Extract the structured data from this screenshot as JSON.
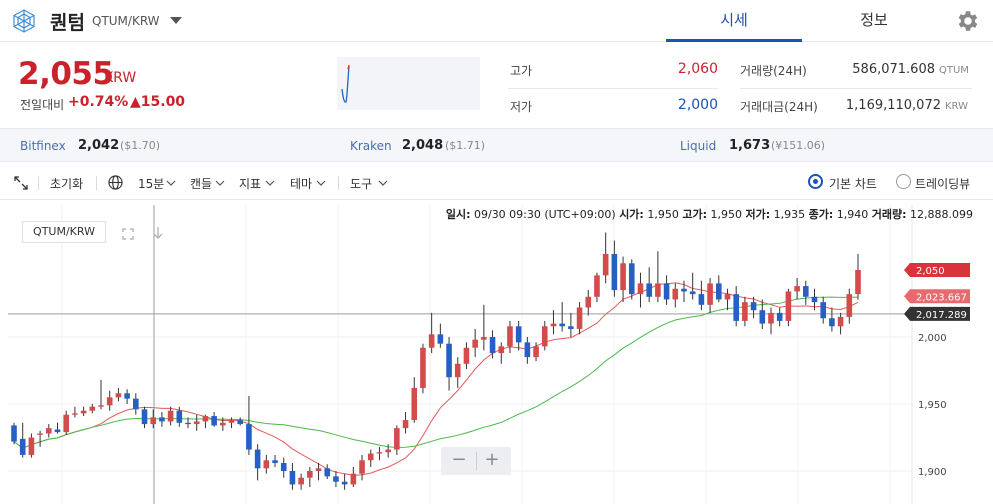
{
  "header": {
    "coin_name": "퀀텀",
    "pair": "QTUM/KRW",
    "tabs": [
      {
        "label": "시세",
        "active": true
      },
      {
        "label": "정보",
        "active": false
      }
    ],
    "icons": {
      "logo": "qtum-logo-icon",
      "dropdown": "triangle-down-icon",
      "settings": "gear-icon"
    }
  },
  "price": {
    "current": "2,055",
    "unit": "KRW",
    "change_label": "전일대비",
    "change_pct": "+0.74%",
    "change_abs": "▲15.00",
    "color": "#c8232c"
  },
  "stats": {
    "high_label": "고가",
    "high_value": "2,060",
    "high_color": "#c8232c",
    "low_label": "저가",
    "low_value": "2,000",
    "low_color": "#1a52b5",
    "volume_label": "거래량(24H)",
    "volume_value": "586,071.608",
    "volume_unit": "QTUM",
    "amount_label": "거래대금(24H)",
    "amount_value": "1,169,110,072",
    "amount_unit": "KRW"
  },
  "exchanges": [
    {
      "name": "Bitfinex",
      "price": "2,042",
      "sub": "($1.70)"
    },
    {
      "name": "Kraken",
      "price": "2,048",
      "sub": "($1.71)"
    },
    {
      "name": "Liquid",
      "price": "1,673",
      "sub": "(¥151.06)"
    }
  ],
  "toolbar": {
    "expand_icon": "expand-arrows-icon",
    "reset": "초기화",
    "globe_icon": "globe-icon",
    "interval": "15분",
    "candle": "캔들",
    "indicator": "지표",
    "theme": "테마",
    "tools": "도구",
    "chart_basic": "기본 차트",
    "chart_tradingview": "트레이딩뷰"
  },
  "ohlc": {
    "time_label": "일시:",
    "time": "09/30 09:30 (UTC+09:00)",
    "open_label": "시가:",
    "open": "1,950",
    "high_label": "고가:",
    "high": "1,950",
    "low_label": "저가:",
    "low": "1,935",
    "close_label": "종가:",
    "close": "1,940",
    "volume_label": "거래량:",
    "volume": "12,888.099"
  },
  "chart_pair_label": "QTUM/KRW",
  "zoom": {
    "minus": "−",
    "plus": "+"
  },
  "chart_data": {
    "type": "candlestick",
    "ylim": [
      1880,
      2120
    ],
    "y_ticks": [
      1900,
      1950,
      2000
    ],
    "y_tick_labels": [
      "1,900",
      "1,950",
      "2,000"
    ],
    "price_tags": [
      {
        "label": "2,050",
        "value": 2050,
        "color": "#d9343b"
      },
      {
        "label": "2,023.667",
        "value": 2023.667,
        "color": "#e86a6f"
      },
      {
        "label": "2,017.289",
        "value": 2017.289,
        "color": "#333333"
      }
    ],
    "up_color": "#d44b4b",
    "down_color": "#2660c4",
    "ma_short_color": "#e25b5b",
    "ma_long_color": "#4cb84c",
    "candles": [
      [
        1934,
        1936,
        1920,
        1922
      ],
      [
        1924,
        1936,
        1910,
        1912
      ],
      [
        1912,
        1928,
        1910,
        1925
      ],
      [
        1927,
        1930,
        1918,
        1928
      ],
      [
        1928,
        1935,
        1925,
        1932
      ],
      [
        1931,
        1936,
        1928,
        1929
      ],
      [
        1929,
        1945,
        1927,
        1942
      ],
      [
        1942,
        1948,
        1940,
        1943
      ],
      [
        1943,
        1948,
        1941,
        1945
      ],
      [
        1945,
        1950,
        1943,
        1948
      ],
      [
        1948,
        1968,
        1946,
        1949
      ],
      [
        1949,
        1960,
        1945,
        1955
      ],
      [
        1955,
        1962,
        1952,
        1958
      ],
      [
        1958,
        1961,
        1950,
        1954
      ],
      [
        1954,
        1958,
        1942,
        1946
      ],
      [
        1946,
        1948,
        1932,
        1935
      ],
      [
        1935,
        1946,
        1932,
        1940
      ],
      [
        1940,
        1944,
        1933,
        1937
      ],
      [
        1937,
        1948,
        1934,
        1945
      ],
      [
        1945,
        1948,
        1933,
        1936
      ],
      [
        1936,
        1940,
        1932,
        1935
      ],
      [
        1935,
        1942,
        1930,
        1937
      ],
      [
        1937,
        1942,
        1932,
        1941
      ],
      [
        1941,
        1944,
        1933,
        1934
      ],
      [
        1934,
        1940,
        1930,
        1936
      ],
      [
        1936,
        1940,
        1932,
        1938
      ],
      [
        1938,
        1940,
        1934,
        1935
      ],
      [
        1935,
        1956,
        1912,
        1916
      ],
      [
        1916,
        1920,
        1893,
        1902
      ],
      [
        1902,
        1912,
        1898,
        1908
      ],
      [
        1908,
        1912,
        1903,
        1906
      ],
      [
        1906,
        1910,
        1895,
        1900
      ],
      [
        1900,
        1906,
        1886,
        1890
      ],
      [
        1890,
        1898,
        1886,
        1895
      ],
      [
        1895,
        1903,
        1888,
        1900
      ],
      [
        1900,
        1906,
        1893,
        1902
      ],
      [
        1902,
        1905,
        1894,
        1896
      ],
      [
        1896,
        1900,
        1888,
        1892
      ],
      [
        1892,
        1898,
        1886,
        1890
      ],
      [
        1890,
        1903,
        1888,
        1898
      ],
      [
        1898,
        1912,
        1893,
        1908
      ],
      [
        1908,
        1916,
        1903,
        1913
      ],
      [
        1913,
        1918,
        1908,
        1914
      ],
      [
        1914,
        1920,
        1910,
        1916
      ],
      [
        1916,
        1934,
        1912,
        1932
      ],
      [
        1932,
        1944,
        1928,
        1938
      ],
      [
        1938,
        1970,
        1936,
        1962
      ],
      [
        1962,
        1995,
        1958,
        1992
      ],
      [
        1992,
        2018,
        1988,
        2002
      ],
      [
        2002,
        2010,
        1992,
        1995
      ],
      [
        1995,
        2000,
        1960,
        1970
      ],
      [
        1970,
        1985,
        1962,
        1980
      ],
      [
        1980,
        1996,
        1976,
        1992
      ],
      [
        1992,
        2006,
        1985,
        1998
      ],
      [
        1998,
        2024,
        1990,
        2000
      ],
      [
        2000,
        2005,
        1984,
        1988
      ],
      [
        1988,
        1996,
        1980,
        1993
      ],
      [
        1993,
        2012,
        1988,
        2008
      ],
      [
        2008,
        2012,
        1990,
        1996
      ],
      [
        1996,
        2000,
        1980,
        1985
      ],
      [
        1985,
        1996,
        1982,
        1993
      ],
      [
        1993,
        2012,
        1990,
        2008
      ],
      [
        2008,
        2020,
        2002,
        2010
      ],
      [
        2010,
        2026,
        2004,
        2008
      ],
      [
        2008,
        2018,
        2000,
        2006
      ],
      [
        2006,
        2026,
        2002,
        2022
      ],
      [
        2022,
        2035,
        2016,
        2030
      ],
      [
        2030,
        2048,
        2026,
        2046
      ],
      [
        2046,
        2078,
        2040,
        2062
      ],
      [
        2062,
        2072,
        2030,
        2035
      ],
      [
        2035,
        2060,
        2026,
        2055
      ],
      [
        2055,
        2058,
        2028,
        2032
      ],
      [
        2032,
        2048,
        2022,
        2040
      ],
      [
        2040,
        2052,
        2026,
        2030
      ],
      [
        2030,
        2064,
        2026,
        2040
      ],
      [
        2040,
        2046,
        2024,
        2028
      ],
      [
        2028,
        2040,
        2022,
        2036
      ],
      [
        2036,
        2042,
        2026,
        2034
      ],
      [
        2034,
        2048,
        2028,
        2032
      ],
      [
        2032,
        2042,
        2020,
        2024
      ],
      [
        2024,
        2044,
        2018,
        2040
      ],
      [
        2040,
        2046,
        2026,
        2028
      ],
      [
        2028,
        2036,
        2020,
        2032
      ],
      [
        2032,
        2038,
        2008,
        2012
      ],
      [
        2012,
        2030,
        2008,
        2026
      ],
      [
        2026,
        2030,
        2014,
        2020
      ],
      [
        2020,
        2028,
        2006,
        2010
      ],
      [
        2010,
        2022,
        2002,
        2018
      ],
      [
        2018,
        2022,
        2008,
        2012
      ],
      [
        2012,
        2036,
        2008,
        2034
      ],
      [
        2034,
        2044,
        2028,
        2038
      ],
      [
        2038,
        2042,
        2024,
        2030
      ],
      [
        2030,
        2036,
        2020,
        2026
      ],
      [
        2026,
        2030,
        2010,
        2014
      ],
      [
        2014,
        2022,
        2004,
        2008
      ],
      [
        2008,
        2018,
        2002,
        2015
      ],
      [
        2015,
        2036,
        2010,
        2032
      ],
      [
        2032,
        2062,
        2028,
        2050
      ]
    ]
  }
}
